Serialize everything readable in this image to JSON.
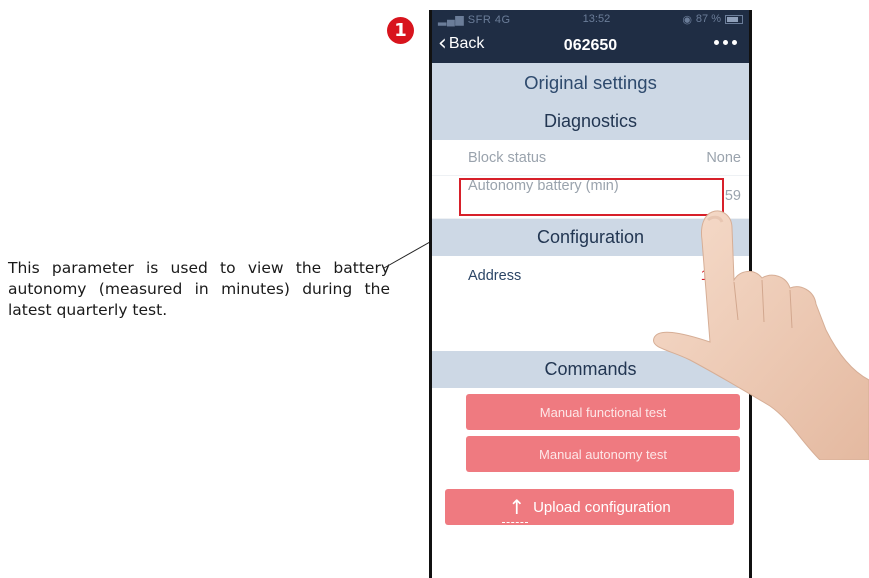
{
  "step": {
    "number": "1"
  },
  "caption": {
    "text": "This parameter is used to view the battery autonomy (measured in minutes) during the latest quarterly test."
  },
  "status_bar": {
    "carrier": "SFR",
    "network": "4G",
    "time": "13:52",
    "battery": "87 %"
  },
  "nav": {
    "back_label": "Back",
    "title": "062650"
  },
  "sections": {
    "original": "Original settings",
    "diagnostics": "Diagnostics",
    "configuration": "Configuration",
    "commands": "Commands"
  },
  "diagnostics": {
    "block_status": {
      "label": "Block status",
      "value": "None"
    },
    "autonomy_battery": {
      "label": "Autonomy battery (min)",
      "value": "59"
    }
  },
  "configuration": {
    "address": {
      "label": "Address",
      "value": "102"
    }
  },
  "commands": {
    "manual_functional_test": "Manual functional test",
    "manual_autonomy_test": "Manual autonomy test"
  },
  "upload": {
    "label": "Upload configuration"
  },
  "colors": {
    "nav_bg": "#1f2d44",
    "section_bg": "#cdd8e5",
    "button_bg": "#ef7a80",
    "highlight": "#d7202a"
  }
}
